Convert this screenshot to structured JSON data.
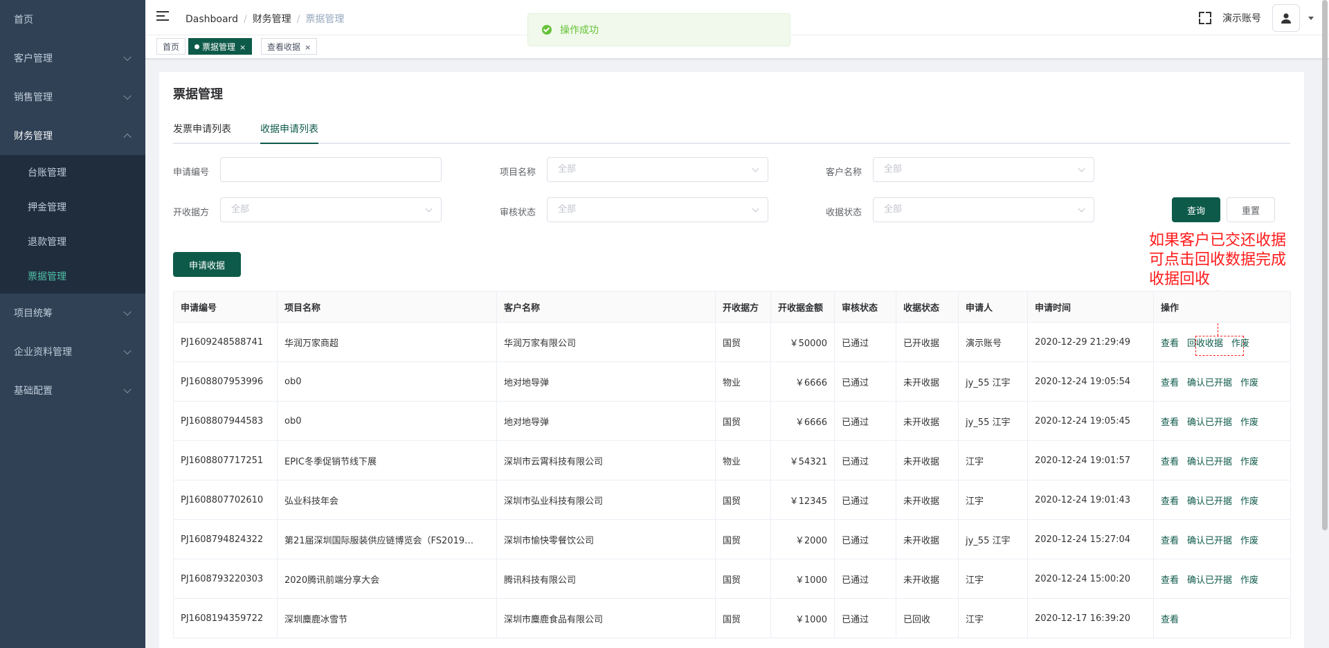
{
  "sidebar": {
    "items": [
      {
        "label": "首页",
        "has_children": false
      },
      {
        "label": "客户管理",
        "has_children": true
      },
      {
        "label": "销售管理",
        "has_children": true
      },
      {
        "label": "财务管理",
        "has_children": true,
        "expanded": true
      }
    ],
    "finance_children": [
      "台账管理",
      "押金管理",
      "退款管理",
      "票据管理"
    ],
    "active_child": "票据管理",
    "after_items": [
      "项目统筹",
      "企业资料管理",
      "基础配置"
    ]
  },
  "breadcrumb": [
    "Dashboard",
    "财务管理",
    "票据管理"
  ],
  "header": {
    "account": "演示账号"
  },
  "tags": [
    "首页",
    "票据管理",
    "查看收据"
  ],
  "tag_close": "×",
  "toast": "操作成功",
  "page": {
    "title": "票据管理",
    "tabs": [
      "发票申请列表",
      "收据申请列表"
    ],
    "active_tab": 1
  },
  "filters": {
    "apply_no": "申请编号",
    "project": "项目名称",
    "customer": "客户名称",
    "issuer": "开收据方",
    "audit": "审核状态",
    "receipt_status": "收据状态",
    "placeholder_all": "全部"
  },
  "buttons": {
    "query": "查询",
    "reset": "重置",
    "apply": "申请收据"
  },
  "annotation": [
    "如果客户已交还收据",
    "可点击回收数据完成",
    "收据回收"
  ],
  "table": {
    "columns": [
      "申请编号",
      "项目名称",
      "客户名称",
      "开收据方",
      "开收据金额",
      "审核状态",
      "收据状态",
      "申请人",
      "申请时间",
      "操作"
    ],
    "rows": [
      {
        "no": "PJ1609248588741",
        "project": "华润万家商超",
        "customer": "华润万家有限公司",
        "issuer": "国贸",
        "amount": "￥50000",
        "audit": "已通过",
        "status": "已开收据",
        "applicant": "演示账号",
        "time": "2020-12-29 21:29:49",
        "ops": [
          "查看",
          "回收收据",
          "作废"
        ]
      },
      {
        "no": "PJ1608807953996",
        "project": "ob0",
        "customer": "地对地导弹",
        "issuer": "物业",
        "amount": "￥6666",
        "audit": "已通过",
        "status": "未开收据",
        "applicant": "jy_55 江宇",
        "time": "2020-12-24 19:05:54",
        "ops": [
          "查看",
          "确认已开据",
          "作废"
        ]
      },
      {
        "no": "PJ1608807944583",
        "project": "ob0",
        "customer": "地对地导弹",
        "issuer": "国贸",
        "amount": "￥6666",
        "audit": "已通过",
        "status": "未开收据",
        "applicant": "jy_55 江宇",
        "time": "2020-12-24 19:05:45",
        "ops": [
          "查看",
          "确认已开据",
          "作废"
        ]
      },
      {
        "no": "PJ1608807717251",
        "project": "EPIC冬季促销节线下展",
        "customer": "深圳市云霄科技有限公司",
        "issuer": "物业",
        "amount": "￥54321",
        "audit": "已通过",
        "status": "未开收据",
        "applicant": "江宇",
        "time": "2020-12-24 19:01:57",
        "ops": [
          "查看",
          "确认已开据",
          "作废"
        ]
      },
      {
        "no": "PJ1608807702610",
        "project": "弘业科技年会",
        "customer": "深圳市弘业科技有限公司",
        "issuer": "国贸",
        "amount": "￥12345",
        "audit": "已通过",
        "status": "未开收据",
        "applicant": "江宇",
        "time": "2020-12-24 19:01:43",
        "ops": [
          "查看",
          "确认已开据",
          "作废"
        ]
      },
      {
        "no": "PJ1608794824322",
        "project": "第21届深圳国际服装供应链博览会（FS2019…",
        "customer": "深圳市愉快零餐饮公司",
        "issuer": "国贸",
        "amount": "￥2000",
        "audit": "已通过",
        "status": "未开收据",
        "applicant": "jy_55 江宇",
        "time": "2020-12-24 15:27:04",
        "ops": [
          "查看",
          "确认已开据",
          "作废"
        ]
      },
      {
        "no": "PJ1608793220303",
        "project": "2020腾讯前端分享大会",
        "customer": "腾讯科技有限公司",
        "issuer": "国贸",
        "amount": "￥1000",
        "audit": "已通过",
        "status": "未开收据",
        "applicant": "江宇",
        "time": "2020-12-24 15:00:20",
        "ops": [
          "查看",
          "确认已开据",
          "作废"
        ]
      },
      {
        "no": "PJ1608194359722",
        "project": "深圳麋鹿冰雪节",
        "customer": "深圳市麋鹿食品有限公司",
        "issuer": "国贸",
        "amount": "￥1000",
        "audit": "已通过",
        "status": "已回收",
        "applicant": "江宇",
        "time": "2020-12-17 16:39:20",
        "ops": [
          "查看"
        ]
      }
    ]
  }
}
